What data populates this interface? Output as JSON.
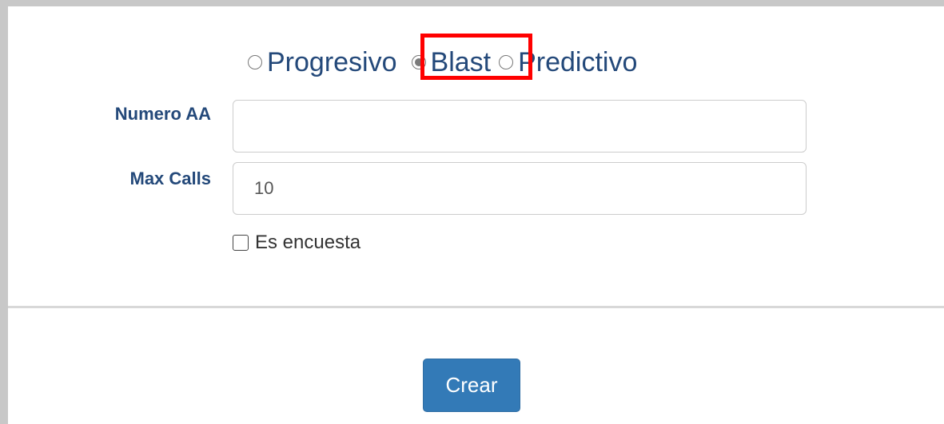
{
  "dial_mode": {
    "options": [
      {
        "label": "Progresivo",
        "checked": false
      },
      {
        "label": "Blast",
        "checked": true
      },
      {
        "label": "Predictivo",
        "checked": false
      }
    ],
    "highlight_color": "#ff0000"
  },
  "form": {
    "numero_aa": {
      "label": "Numero AA",
      "value": ""
    },
    "max_calls": {
      "label": "Max Calls",
      "value": "10"
    },
    "es_encuesta": {
      "label": "Es encuesta",
      "checked": false
    }
  },
  "actions": {
    "create_label": "Crear",
    "create_color": "#337ab7"
  },
  "colors": {
    "label_text": "#24497a",
    "frame_border": "#c8c8c8"
  }
}
